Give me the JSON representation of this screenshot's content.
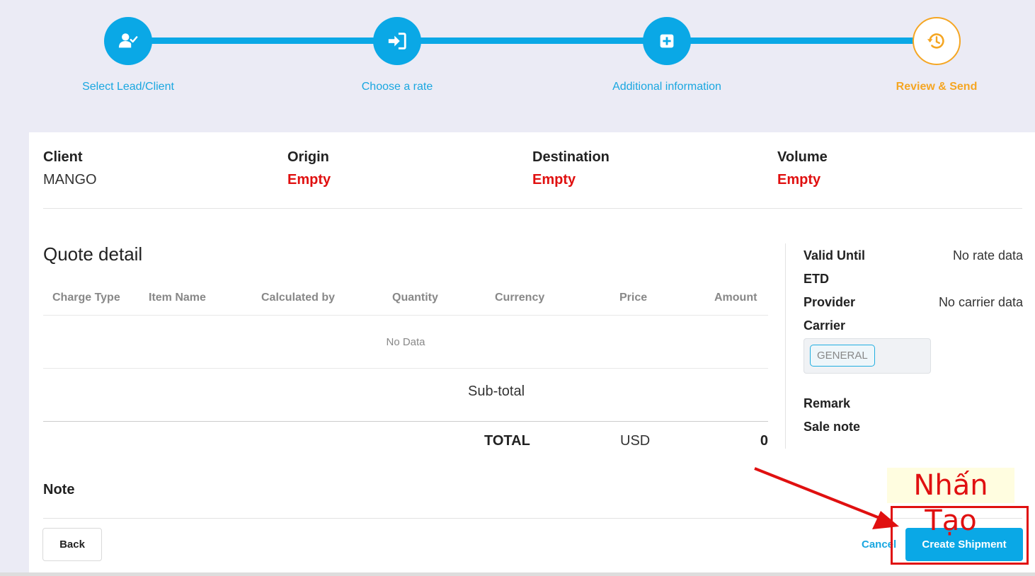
{
  "stepper": {
    "steps": [
      {
        "label": "Select Lead/Client",
        "icon": "user-check-icon",
        "active": false
      },
      {
        "label": "Choose a rate",
        "icon": "sign-in-icon",
        "active": false
      },
      {
        "label": "Additional information",
        "icon": "plus-square-icon",
        "active": false
      },
      {
        "label": "Review & Send",
        "icon": "history-icon",
        "active": true
      }
    ],
    "colors": {
      "done": "#0aa8e6",
      "active": "#f5a623"
    }
  },
  "summary": {
    "client": {
      "title": "Client",
      "value": "MANGO"
    },
    "origin": {
      "title": "Origin",
      "value": "Empty"
    },
    "destination": {
      "title": "Destination",
      "value": "Empty"
    },
    "volume": {
      "title": "Volume",
      "value": "Empty"
    }
  },
  "quote": {
    "title": "Quote detail",
    "columns": [
      "Charge Type",
      "Item Name",
      "Calculated by",
      "Quantity",
      "Currency",
      "Price",
      "Amount"
    ],
    "empty_text": "No Data",
    "subtotal_label": "Sub-total",
    "total_label": "TOTAL",
    "total_currency": "USD",
    "total_value": "0"
  },
  "side": {
    "valid_until": {
      "label": "Valid Until",
      "value": "No rate data"
    },
    "etd": {
      "label": "ETD"
    },
    "provider": {
      "label": "Provider",
      "value": "No carrier data"
    },
    "carrier": {
      "label": "Carrier",
      "tag": "GENERAL"
    },
    "remark": {
      "label": "Remark"
    },
    "sale_note": {
      "label": "Sale note"
    }
  },
  "note": {
    "label": "Note"
  },
  "actions": {
    "back": "Back",
    "cancel": "Cancel",
    "create": "Create Shipment"
  },
  "annotation": {
    "text": "Nhấn Tạo",
    "color": "#e01010"
  }
}
